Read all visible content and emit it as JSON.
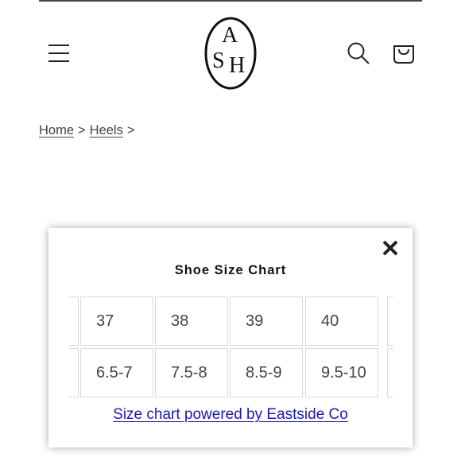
{
  "header": {
    "menu_icon": "hamburger-menu-icon",
    "search_icon": "search-icon",
    "cart_icon": "cart-icon",
    "logo": {
      "letters": [
        "A",
        "S",
        "H"
      ]
    }
  },
  "breadcrumb": {
    "items": [
      {
        "label": "Home"
      },
      {
        "label": "Heels"
      }
    ],
    "separator": ">"
  },
  "modal": {
    "title": "Shoe Size Chart",
    "close_icon": "close-x-icon",
    "rows": [
      [
        "37",
        "38",
        "39",
        "40"
      ],
      [
        "6.5-7",
        "7.5-8",
        "8.5-9",
        "9.5-10"
      ]
    ],
    "powered_by": "Size chart powered by Eastside Co"
  }
}
